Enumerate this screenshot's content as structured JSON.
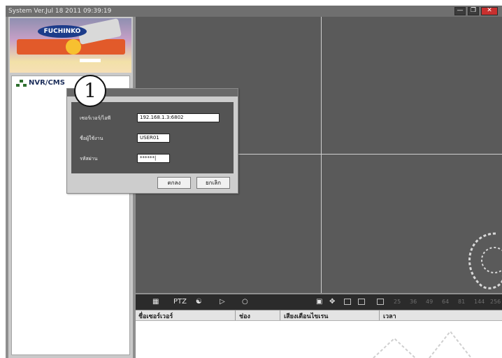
{
  "window": {
    "title": "System Ver.Jul 18 2011 09:39:19",
    "controls": [
      "minimize-icon",
      "restore-icon",
      "close-icon"
    ]
  },
  "sidebar": {
    "logo": {
      "brand": "FUCHINKO"
    },
    "tree": {
      "root_label": "NVR/CMS"
    }
  },
  "annotation": {
    "step": "1"
  },
  "login_dialog": {
    "server_label": "เซอร์เวอร์/ไอพี",
    "server_value": "192.168.1.3:6802",
    "user_label": "ชื่อผู้ใช้งาน",
    "user_value": "USER01",
    "password_label": "รหัสผ่าน",
    "password_value": "******|",
    "ok_label": "ตกลง",
    "cancel_label": "ยกเลิก"
  },
  "toolbar": {
    "ptz_label": "PTZ",
    "layout_counts": [
      "25",
      "36",
      "49",
      "64",
      "81",
      "144",
      "256"
    ]
  },
  "event_table": {
    "columns": [
      "ชื่อเซอร์เวอร์",
      "ช่อง",
      "เสียงเตือนไขเรน",
      "เวลา"
    ]
  },
  "colors": {
    "video_bg": "#5a5a5a",
    "toolbar_bg": "#2b2b2b",
    "close_button": "#c8302f"
  }
}
